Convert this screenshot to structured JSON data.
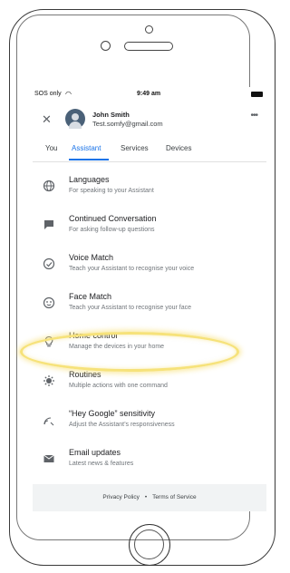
{
  "status_bar": {
    "carrier": "SOS only",
    "time": "9:49 am"
  },
  "account": {
    "name": "John Smith",
    "email": "Test.somfy@gmail.com"
  },
  "tabs": [
    {
      "label": "You",
      "active": false
    },
    {
      "label": "Assistant",
      "active": true
    },
    {
      "label": "Services",
      "active": false
    },
    {
      "label": "Devices",
      "active": false
    }
  ],
  "settings": [
    {
      "title": "Languages",
      "subtitle": "For speaking to your Assistant",
      "icon": "globe-icon"
    },
    {
      "title": "Continued Conversation",
      "subtitle": "For asking follow-up questions",
      "icon": "conversation-icon"
    },
    {
      "title": "Voice Match",
      "subtitle": "Teach your Assistant to recognise your voice",
      "icon": "voice-match-icon"
    },
    {
      "title": "Face Match",
      "subtitle": "Teach your Assistant to recognise your face",
      "icon": "face-icon"
    },
    {
      "title": "Home control",
      "subtitle": "Manage the devices in your home",
      "icon": "lightbulb-icon"
    },
    {
      "title": "Routines",
      "subtitle": "Multiple actions with one command",
      "icon": "routines-icon"
    },
    {
      "title": "“Hey Google” sensitivity",
      "subtitle": "Adjust the Assistant’s responsiveness",
      "icon": "sensitivity-icon"
    },
    {
      "title": "Email updates",
      "subtitle": "Latest news & features",
      "icon": "email-icon"
    }
  ],
  "footer": {
    "privacy": "Privacy Policy",
    "separator": "•",
    "terms": "Terms of Service"
  },
  "colors": {
    "accent": "#1a73e8",
    "highlight": "#f6e27a"
  }
}
